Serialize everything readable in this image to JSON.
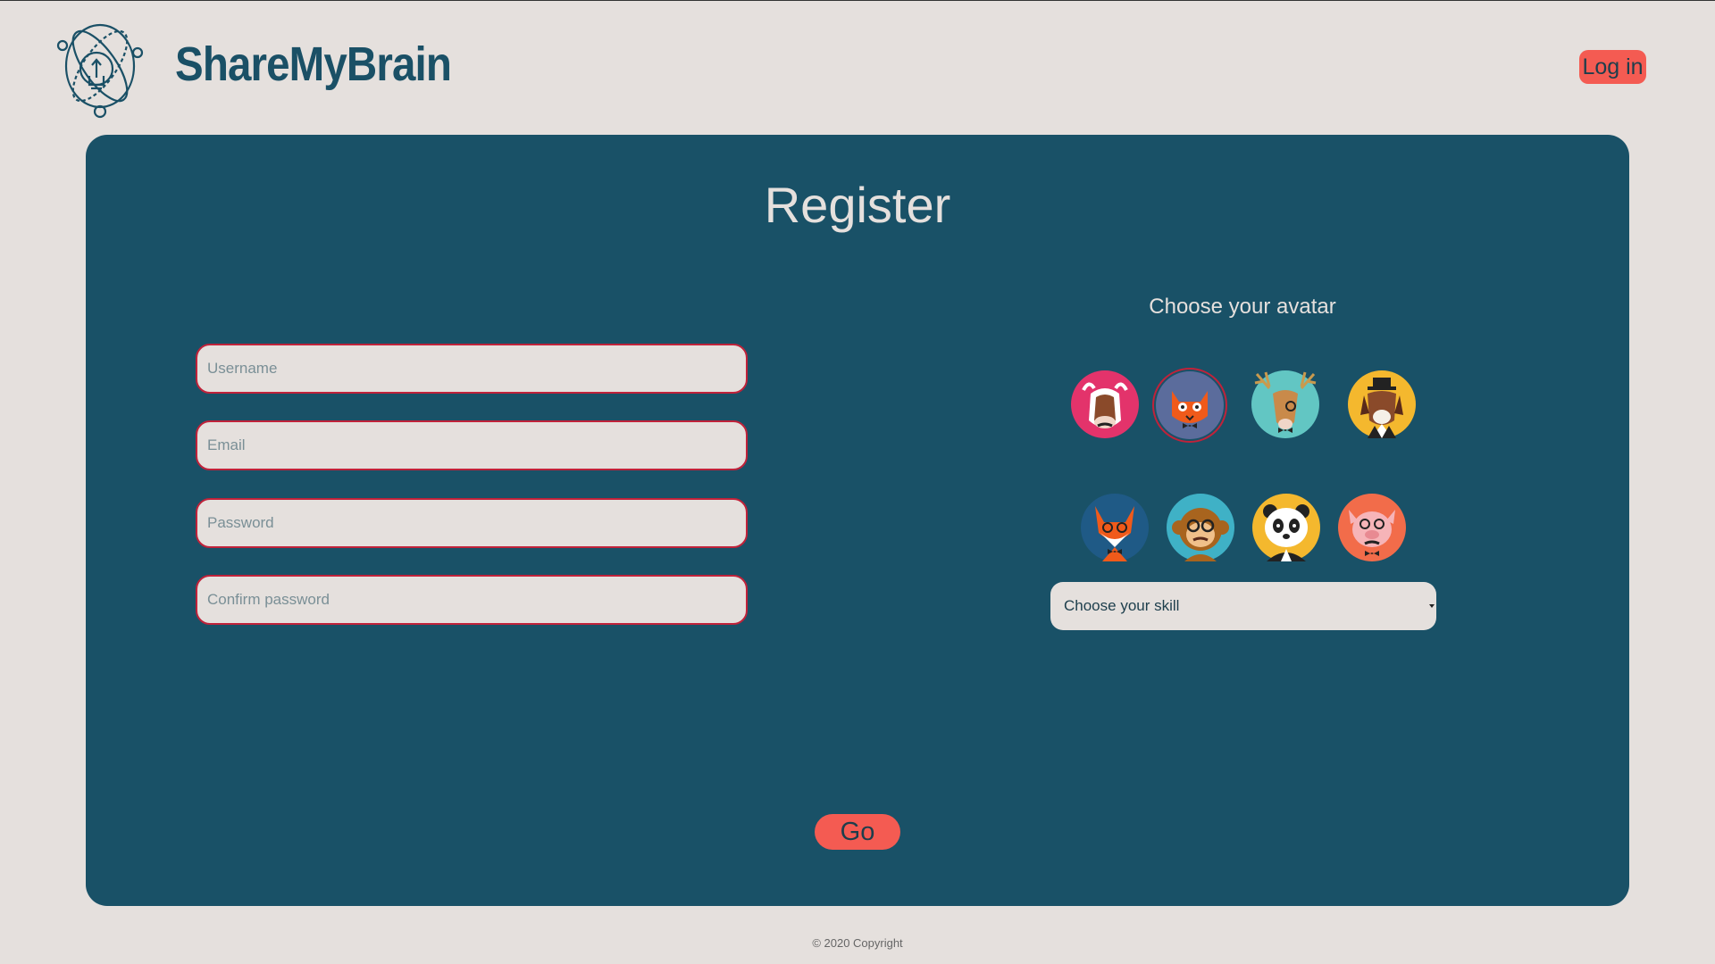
{
  "header": {
    "brand": "ShareMyBrain",
    "login_label": "Log in"
  },
  "register": {
    "title": "Register",
    "fields": {
      "username_placeholder": "Username",
      "email_placeholder": "Email",
      "password_placeholder": "Password",
      "confirm_placeholder": "Confirm password"
    },
    "avatar_title": "Choose your avatar",
    "avatars": [
      {
        "name": "cow",
        "bg": "#e3336b",
        "selected": false
      },
      {
        "name": "cat",
        "bg": "#5b6c9c",
        "selected": true
      },
      {
        "name": "deer",
        "bg": "#62c6c3",
        "selected": false
      },
      {
        "name": "dog",
        "bg": "#f4b82e",
        "selected": false
      },
      {
        "name": "fox",
        "bg": "#1f5a86",
        "selected": false
      },
      {
        "name": "monkey",
        "bg": "#3fb1c6",
        "selected": false
      },
      {
        "name": "panda",
        "bg": "#f4b82e",
        "selected": false
      },
      {
        "name": "pig",
        "bg": "#f26c4a",
        "selected": false
      }
    ],
    "skill_select": "Choose your skill",
    "go_label": "Go"
  },
  "footer": {
    "copyright": "© 2020 Copyright"
  },
  "colors": {
    "background": "#e5e0dd",
    "card": "#195167",
    "accent": "#f45b52",
    "field_border": "#c0223a",
    "brand": "#1a5066"
  }
}
